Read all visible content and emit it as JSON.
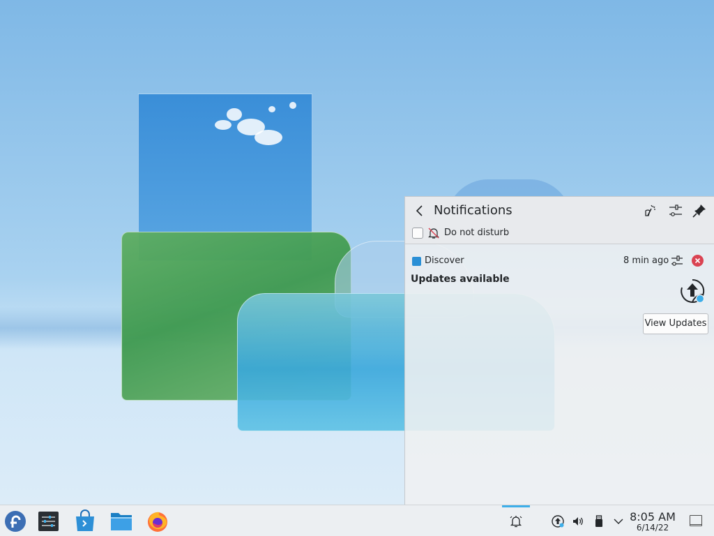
{
  "panel": {
    "title": "Notifications",
    "do_not_disturb_label": "Do not disturb",
    "do_not_disturb_checked": false,
    "header_buttons": [
      "clear-all-icon",
      "configure-icon",
      "pin-icon"
    ]
  },
  "notification": {
    "app_name": "Discover",
    "time": "8 min ago",
    "summary": "Updates available",
    "action_label": "View Updates"
  },
  "taskbar": {
    "launchers": [
      "fedora-logo-icon",
      "system-settings-icon",
      "discover-icon",
      "file-manager-icon",
      "firefox-icon"
    ],
    "tray": [
      "notifications-bell-icon",
      "updates-icon",
      "volume-icon",
      "usb-device-icon",
      "expand-tray-chevron-icon"
    ],
    "clock_time": "8:05 AM",
    "clock_date": "6/14/22"
  },
  "colors": {
    "accent": "#3daee9",
    "close_red": "#da4453",
    "text": "#232629"
  }
}
